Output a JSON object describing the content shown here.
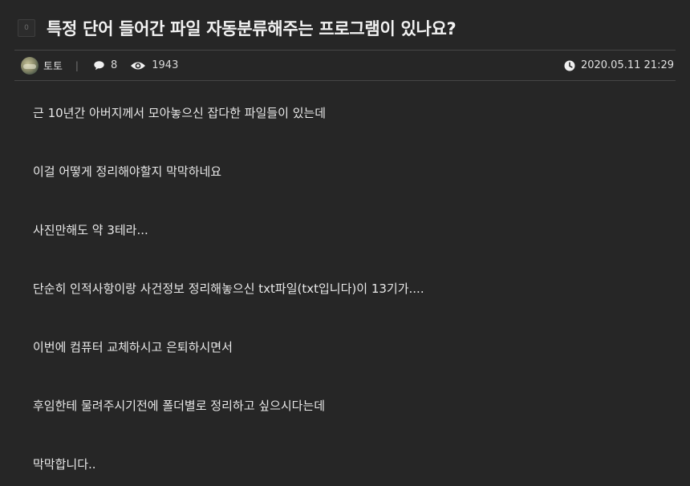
{
  "post": {
    "category_badge": "0",
    "title": "특정 단어 들어간 파일 자동분류해주는 프로그램이 있나요?"
  },
  "meta": {
    "author": "토토",
    "separator": "|",
    "comment_count": "8",
    "view_count": "1943",
    "datetime": "2020.05.11 21:29",
    "icons": {
      "comment": "comment-bubble-icon",
      "views": "eye-icon",
      "time": "clock-icon"
    }
  },
  "body": {
    "paragraphs": [
      "근 10년간 아버지께서 모아놓으신 잡다한 파일들이 있는데",
      "이걸 어떻게 정리해야할지 막막하네요",
      "사진만해도 약 3테라...",
      "단순히 인적사항이랑 사건정보 정리해놓으신 txt파일(txt입니다)이 13기가....",
      "이번에 컴퓨터 교체하시고 은퇴하시면서",
      "후임한테 물려주시기전에 폴더별로 정리하고 싶으시다는데",
      "막막합니다.."
    ]
  },
  "colors": {
    "background": "#262626",
    "divider": "#464646",
    "text": "#e8e8e8"
  }
}
